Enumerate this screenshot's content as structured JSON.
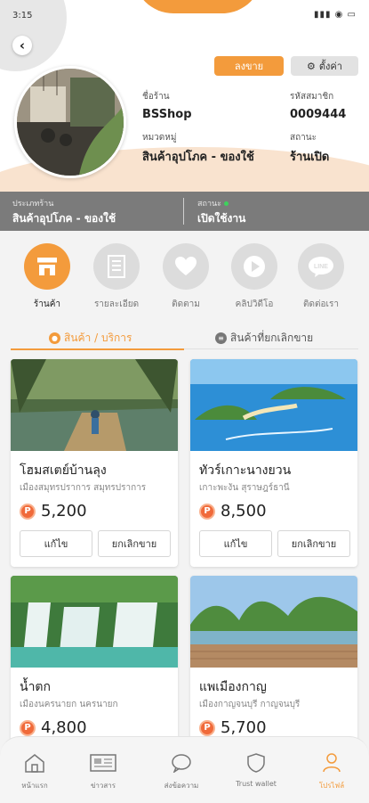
{
  "status_bar": {
    "time": "3:15",
    "signal": "▮▮▮ ◉ ▭"
  },
  "header": {
    "sell_button": "ลงขาย",
    "settings_button": "ตั้งค่า",
    "shop_name_label": "ชื่อร้าน",
    "shop_name": "BSShop",
    "member_code_label": "รหัสสมาชิก",
    "member_code": "0009444",
    "category_label": "หมวดหมู่",
    "category": "สินค้าอุปโภค - ของใช้",
    "status_label": "สถานะ",
    "status": "ร้านเปิด"
  },
  "info_bar": {
    "shop_type_label": "ประเภทร้าน",
    "shop_type": "สินค้าอุปโภค - ของใช้",
    "state_label": "สถานะ",
    "state": "เปิดใช้งาน",
    "status_color": "#3ed25c"
  },
  "menu": [
    {
      "label": "ร้านค้า",
      "icon": "shop-icon",
      "active": true
    },
    {
      "label": "รายละเอียด",
      "icon": "document-icon",
      "active": false
    },
    {
      "label": "ติดตาม",
      "icon": "heart-icon",
      "active": false
    },
    {
      "label": "คลิปวิดีโอ",
      "icon": "play-icon",
      "active": false
    },
    {
      "label": "ติดต่อเรา",
      "icon": "line-icon",
      "active": false
    }
  ],
  "tabs": {
    "products": "สินค้า / บริการ",
    "cancelled": "สินค้าที่ยกเลิกขาย"
  },
  "products": [
    {
      "title": "โฮมสเตย์บ้านลุง",
      "location": "เมืองสมุทรปราการ สมุทรปราการ",
      "price": "5,200",
      "edit": "แก้ไข",
      "cancel": "ยกเลิกขาย"
    },
    {
      "title": "ทัวร์เกาะนางยวน",
      "location": "เกาะพะงัน สุราษฎร์ธานี",
      "price": "8,500",
      "edit": "แก้ไข",
      "cancel": "ยกเลิกขาย"
    },
    {
      "title": "น้ำตก",
      "location": "เมืองนครนายก นครนายก",
      "price": "4,800"
    },
    {
      "title": "แพเมืองกาญ",
      "location": "เมืองกาญจนบุรี กาญจนบุรี",
      "price": "5,700"
    }
  ],
  "coin_symbol": "P",
  "bottom_nav": [
    {
      "label": "หน้าแรก",
      "icon": "home-icon",
      "active": false
    },
    {
      "label": "ข่าวสาร",
      "icon": "news-icon",
      "active": false
    },
    {
      "label": "ส่งข้อความ",
      "icon": "chat-icon",
      "active": false
    },
    {
      "label": "Trust wallet",
      "icon": "shield-icon",
      "active": false
    },
    {
      "label": "โปรไฟล์",
      "icon": "profile-icon",
      "active": true
    }
  ],
  "colors": {
    "accent": "#f39b3c",
    "bar_gray": "#7b7b7b"
  }
}
